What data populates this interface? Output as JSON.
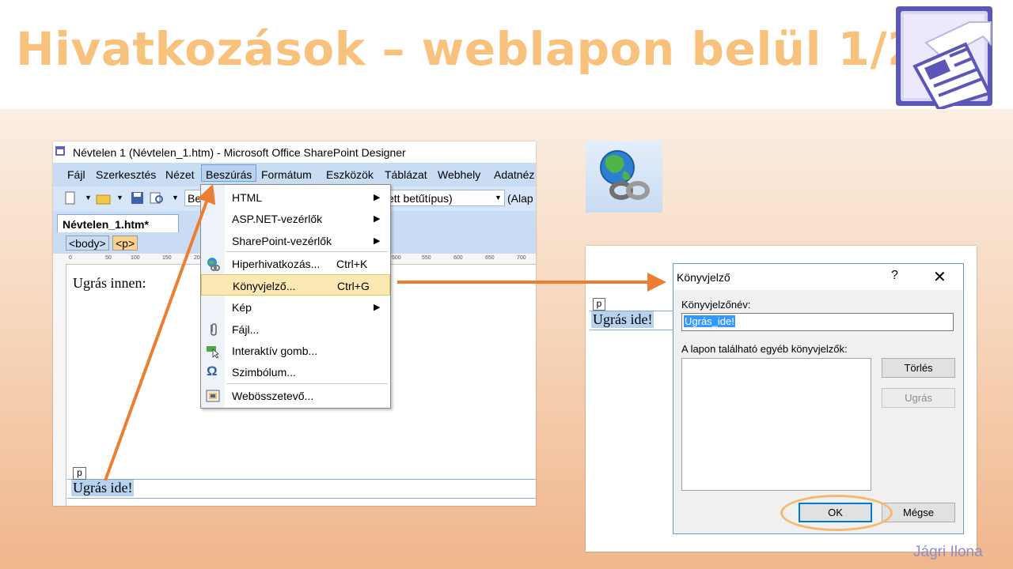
{
  "slide": {
    "title": "Hivatkozások – weblapon belül 1/2.",
    "author": "Jágri Ilona"
  },
  "editor": {
    "window_title": "Névtelen 1 (Névtelen_1.htm) - Microsoft Office SharePoint Designer",
    "menu": [
      "Fájl",
      "Szerkesztés",
      "Nézet",
      "Beszúrás",
      "Formátum",
      "Eszközök",
      "Táblázat",
      "Webhely",
      "Adatnéz"
    ],
    "toolbar_font": "ett betűtípus)",
    "toolbar_size": "(Alap",
    "toolbar_fragment": "Be",
    "tab": "Névtelen_1.htm*",
    "tags": [
      "<body>",
      "<p>"
    ],
    "ruler_labels": [
      "0",
      "50",
      "100",
      "150",
      "200",
      "500",
      "550",
      "600",
      "650",
      "700"
    ],
    "page_text": "Ugrás innen:",
    "p_marker": "p",
    "target_text": "Ugrás ide!"
  },
  "insert_menu": {
    "items": [
      {
        "label": "HTML",
        "shortcut": "",
        "submenu": true
      },
      {
        "label": "ASP.NET-vezérlők",
        "shortcut": "",
        "submenu": true
      },
      {
        "label": "SharePoint-vezérlők",
        "shortcut": "",
        "submenu": true
      },
      {
        "label": "Hiperhivatkozás...",
        "shortcut": "Ctrl+K",
        "submenu": false
      },
      {
        "label": "Könyvjelző...",
        "shortcut": "Ctrl+G",
        "submenu": false,
        "highlighted": true
      },
      {
        "label": "Kép",
        "shortcut": "",
        "submenu": true
      },
      {
        "label": "Fájl...",
        "shortcut": "",
        "submenu": false
      },
      {
        "label": "Interaktív gomb...",
        "shortcut": "",
        "submenu": false
      },
      {
        "label": "Szimbólum...",
        "shortcut": "",
        "submenu": false
      },
      {
        "label": "Webösszetevő...",
        "shortcut": "",
        "submenu": false
      }
    ]
  },
  "dialog": {
    "title": "Könyvjelző",
    "help": "?",
    "close": "✕",
    "name_label": "Könyvjelzőnév:",
    "name_value": "Ugrás_ide!",
    "list_label": "A lapon található egyéb könyvjelzők:",
    "btn_delete": "Törlés",
    "btn_goto": "Ugrás",
    "btn_ok": "OK",
    "btn_cancel": "Mégse"
  },
  "preview": {
    "p_marker": "p",
    "text": "Ugrás ide!"
  },
  "colors": {
    "title": "#f8c27d",
    "arrow": "#ed7d31",
    "highlight_ring": "#f5b96d",
    "author": "#8f8fc0"
  }
}
